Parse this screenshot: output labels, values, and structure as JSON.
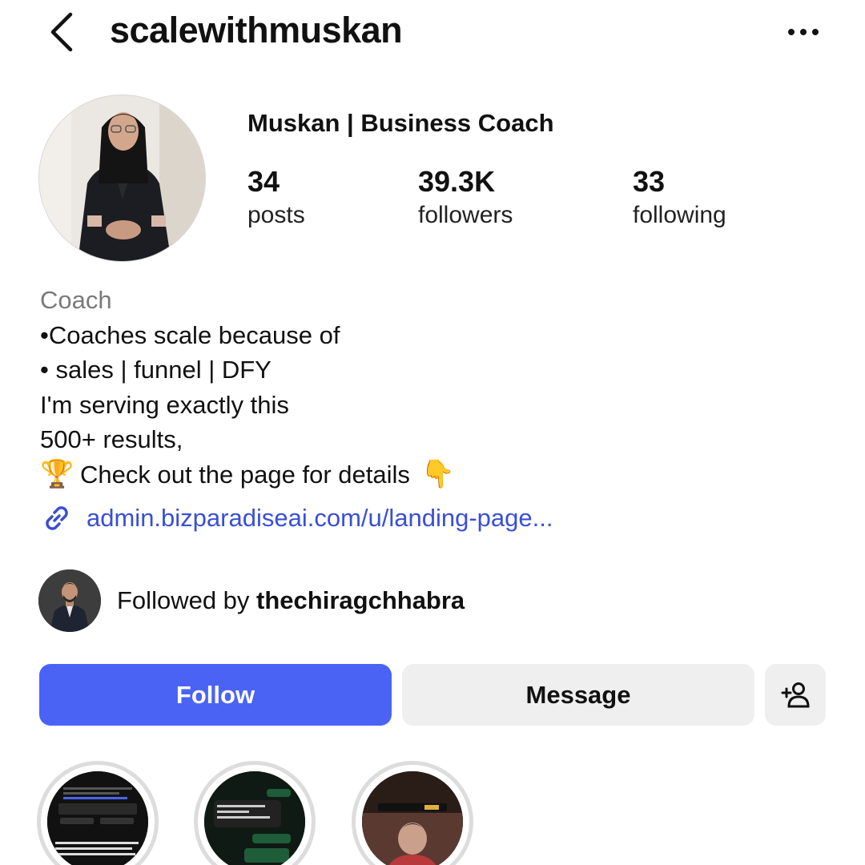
{
  "header": {
    "back_icon": "chevron-left-icon",
    "username": "scalewithmuskan",
    "more_icon": "more-horizontal-icon"
  },
  "profile": {
    "display_name": "Muskan | Business Coach",
    "stats": [
      {
        "value": "34",
        "label": "posts"
      },
      {
        "value": "39.3K",
        "label": "followers"
      },
      {
        "value": "33",
        "label": "following"
      }
    ]
  },
  "bio": {
    "category": "Coach",
    "lines": [
      "•Coaches scale because of",
      "• sales | funnel | DFY",
      "I'm serving exactly this",
      "500+ results,"
    ],
    "cta_emoji": "🏆",
    "cta_text": "Check out the page for details",
    "cta_trailing_emoji": "👇",
    "link_icon": "link-icon",
    "link": "admin.bizparadiseai.com/u/landing-page..."
  },
  "followed_by": {
    "prefix": "Followed by",
    "username": "thechiragchhabra"
  },
  "actions": {
    "follow_label": "Follow",
    "message_label": "Message",
    "add_user_icon": "add-user-icon"
  },
  "colors": {
    "follow_button": "#4a63f5",
    "secondary_button": "#efefef",
    "link": "#3a4fd4",
    "category_text": "#7a7a7a"
  }
}
